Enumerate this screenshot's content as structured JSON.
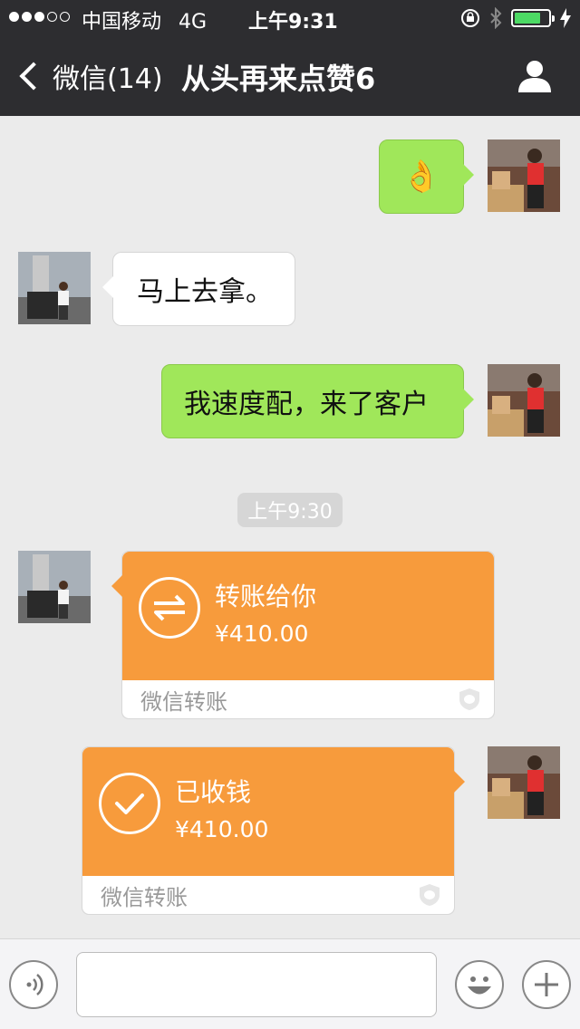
{
  "status_bar": {
    "carrier": "中国移动",
    "network": "4G",
    "time": "上午9:31"
  },
  "nav": {
    "back_label": "微信(14)",
    "title": "从头再来点赞6"
  },
  "messages": {
    "m1": {
      "side": "right",
      "content": "👌"
    },
    "m2": {
      "side": "left",
      "content": "马上去拿。"
    },
    "m3": {
      "side": "right",
      "content": "我速度配，来了客户"
    }
  },
  "timestamp": "上午9:30",
  "transfers": {
    "t1": {
      "side": "left",
      "title": "转账给你",
      "amount": "¥410.00",
      "footer": "微信转账"
    },
    "t2": {
      "side": "right",
      "title": "已收钱",
      "amount": "¥410.00",
      "footer": "微信转账"
    }
  },
  "colors": {
    "header_bg": "#2d2d30",
    "chat_bg": "#ebebeb",
    "sent_bubble": "#a0e75a",
    "transfer_orange": "#f79b3c"
  },
  "icons": {
    "back": "chevron-left-icon",
    "contact": "person-icon",
    "voice": "voice-icon",
    "emoji": "emoji-icon",
    "add": "plus-icon"
  }
}
